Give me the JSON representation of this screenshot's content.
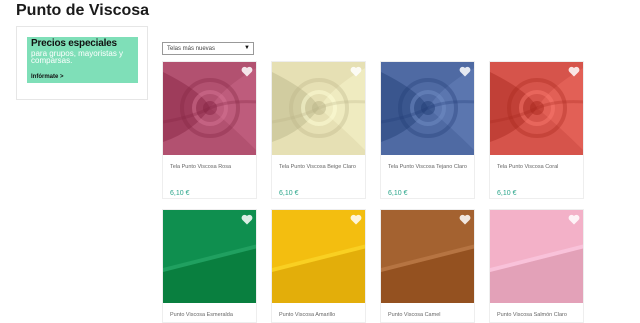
{
  "page": {
    "title": "Punto de Viscosa"
  },
  "promo": {
    "title": "Precios especiales",
    "subtitle": "para grupos, mayoristas y comparsas.",
    "link": "Infórmate >",
    "bg_color": "#7fdfb8"
  },
  "sort": {
    "selected": "Telas más nuevas",
    "arrow_icon": "triangle-down-icon"
  },
  "colors": {
    "price": "#2aa58a",
    "heart": "#ffffff"
  },
  "products": [
    {
      "name": "Tela Punto Viscosa Rosa",
      "price": "6,10 €",
      "swatch": "#b25170"
    },
    {
      "name": "Tela Punto Viscosa Beige Claro",
      "price": "6,10 €",
      "swatch": "#e6e0b4"
    },
    {
      "name": "Tela Punto Viscosa Tejano Claro",
      "price": "6,10 €",
      "swatch": "#4f6aa3"
    },
    {
      "name": "Tela Punto Viscosa Coral",
      "price": "6,10 €",
      "swatch": "#d6544b"
    },
    {
      "name": "Punto Viscosa Esmeralda",
      "price": "",
      "swatch": "#0f8f4f"
    },
    {
      "name": "Punto Viscosa Amarillo",
      "price": "",
      "swatch": "#f3be10"
    },
    {
      "name": "Punto Viscosa Camel",
      "price": "",
      "swatch": "#a46230"
    },
    {
      "name": "Punto Viscosa Salmón Claro",
      "price": "",
      "swatch": "#f3b1c8"
    }
  ]
}
